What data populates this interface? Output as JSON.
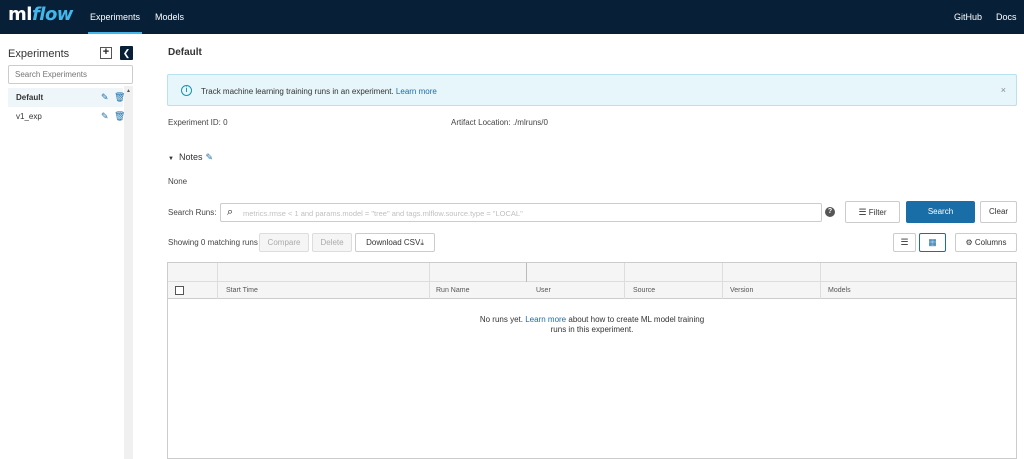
{
  "nav": {
    "logo_ml": "ml",
    "logo_flow": "flow",
    "tabs": [
      "Experiments",
      "Models"
    ],
    "right_links": [
      "GitHub",
      "Docs"
    ]
  },
  "sidebar": {
    "title": "Experiments",
    "add_glyph": "+",
    "collapse_glyph": "❮",
    "search_placeholder": "Search Experiments",
    "items": [
      {
        "label": "Default"
      },
      {
        "label": "v1_exp"
      }
    ]
  },
  "main": {
    "title": "Default",
    "banner": {
      "text": "Track machine learning training runs in an experiment.",
      "link": "Learn more",
      "close": "×"
    },
    "experiment_id_label": "Experiment ID:",
    "experiment_id": "0",
    "artifact_label": "Artifact Location:",
    "artifact_value": "./mlruns/0",
    "notes_label": "Notes",
    "notes_value": "None",
    "search_label": "Search Runs:",
    "search_placeholder": "metrics.rmse < 1 and params.model = \"tree\" and tags.mlflow.source.type = \"LOCAL\"",
    "filter_label": "Filter",
    "search_button": "Search",
    "clear_button": "Clear",
    "showing_text": "Showing 0 matching runs",
    "compare_button": "Compare",
    "delete_button": "Delete",
    "download_button": "Download CSV",
    "columns_button": "Columns",
    "table": {
      "columns": [
        "Start Time",
        "Run Name",
        "User",
        "Source",
        "Version",
        "Models"
      ],
      "empty_prefix": "No runs yet.",
      "empty_link": "Learn more",
      "empty_suffix_1": "about how to create ML model training",
      "empty_suffix_2": "runs in this experiment."
    }
  }
}
